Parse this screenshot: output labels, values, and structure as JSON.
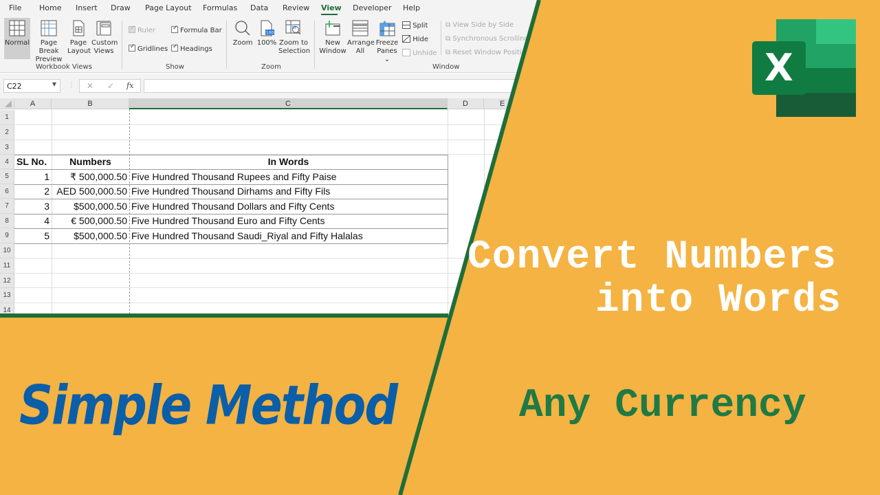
{
  "ribbon": {
    "menu": [
      "File",
      "Home",
      "Insert",
      "Draw",
      "Page Layout",
      "Formulas",
      "Data",
      "Review",
      "View",
      "Developer",
      "Help"
    ],
    "active_tab": "View",
    "workbook_views": {
      "label": "Workbook Views",
      "normal": "Normal",
      "page_break": [
        "Page Break",
        "Preview"
      ],
      "page_layout": [
        "Page",
        "Layout"
      ],
      "custom_views": [
        "Custom",
        "Views"
      ]
    },
    "show": {
      "label": "Show",
      "ruler": "Ruler",
      "formula_bar": "Formula Bar",
      "gridlines": "Gridlines",
      "headings": "Headings"
    },
    "zoom": {
      "label": "Zoom",
      "zoom": "Zoom",
      "hundred": "100%",
      "zoom_sel": [
        "Zoom to",
        "Selection"
      ],
      "hundred_badge": "100"
    },
    "window": {
      "label": "Window",
      "new_window": [
        "New",
        "Window"
      ],
      "arrange_all": [
        "Arrange",
        "All"
      ],
      "freeze_panes": [
        "Freeze",
        "Panes ⌄"
      ],
      "split": "Split",
      "hide": "Hide",
      "unhide": "Unhide",
      "side_by_side": "View Side by Side",
      "sync_scroll": "Synchronous Scrolling",
      "reset_pos": "Reset Window Position"
    }
  },
  "formula_bar": {
    "name_box": "C22",
    "cancel": "✕",
    "enter": "✓",
    "fx": "fx",
    "value": ""
  },
  "sheet": {
    "columns": [
      "A",
      "B",
      "C",
      "D",
      "E"
    ],
    "rows": [
      "1",
      "2",
      "3",
      "4",
      "5",
      "6",
      "7",
      "8",
      "9",
      "10",
      "11",
      "12",
      "13",
      "14"
    ],
    "header": {
      "sl": "SL No.",
      "numbers": "Numbers",
      "words": "In Words"
    },
    "data": [
      {
        "sl": "1",
        "number": "₹ 500,000.50",
        "words": "Five Hundred  Thousand  Rupees and Fifty  Paise"
      },
      {
        "sl": "2",
        "number": "AED 500,000.50",
        "words": "Five Hundred  Thousand  Dirhams and Fifty  Fils"
      },
      {
        "sl": "3",
        "number": "$500,000.50",
        "words": "Five Hundred  Thousand  Dollars and Fifty  Cents"
      },
      {
        "sl": "4",
        "number": "€ 500,000.50",
        "words": "Five Hundred  Thousand  Euro and Fifty  Cents"
      },
      {
        "sl": "5",
        "number": "$500,000.50",
        "words": "Five Hundred  Thousand  Saudi_Riyal and Fifty  Halalas"
      }
    ]
  },
  "banner": {
    "title_line1": "Convert Numbers",
    "title_line2": "into Words",
    "subtitle": "Any Currency",
    "tagline": "Simple Method",
    "logo_letter": "X"
  },
  "colors": {
    "background": "#F4B342",
    "excel_green": "#1F6E3A",
    "title_white": "#FFFFFF",
    "subtitle_green": "#1F7A45",
    "tagline_blue": "#0B5EA8"
  }
}
